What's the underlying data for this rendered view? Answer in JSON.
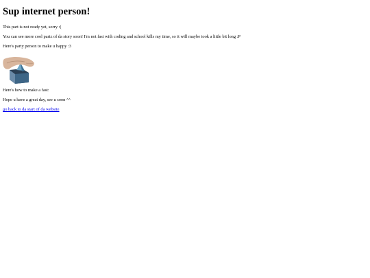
{
  "page": {
    "title": "Sup internet person!",
    "not_ready": "This part is not ready yet, sorry :(",
    "more_soon": "You can see more cool partz of da story soon! I'm not fast with coding and school kills my time, so it will maybe took a little bit long :P",
    "party_intro": "Here's party person to make u happy :3",
    "how_to": "Here's how to make a fast:",
    "goodbye": "Hope u have a great day, see u soon ^^",
    "back_link": "go back to da start of da website"
  },
  "image": {
    "name": "party-person-gif",
    "colors": {
      "hand": "#d8b59c",
      "sleeve": "#4f8fb0",
      "cube_dark": "#2a3f55",
      "cube_light": "#6a8aa8",
      "cone": "#6fa7c7"
    }
  },
  "colors": {
    "link": "#0000ee",
    "text": "#000000",
    "background": "#ffffff"
  }
}
